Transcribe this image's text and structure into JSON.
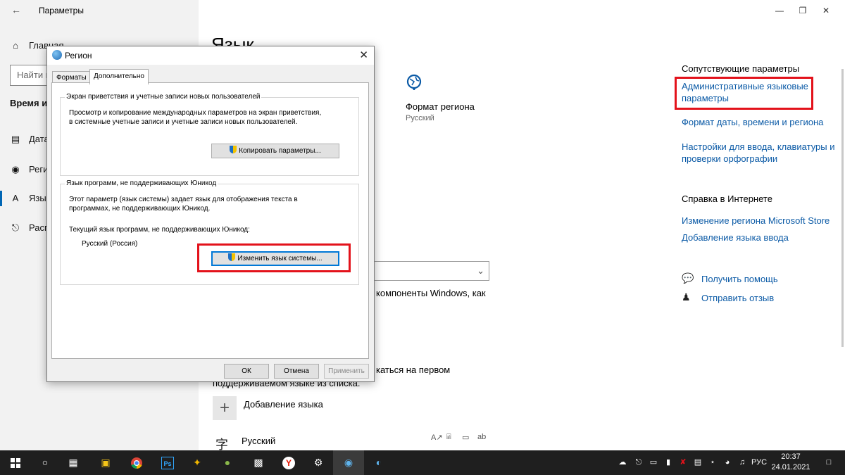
{
  "settings": {
    "window_title": "Параметры",
    "sidebar": {
      "home_label": "Главная",
      "search_placeholder": "Найти параметр",
      "section_label": "Время и язык",
      "items": [
        {
          "label": "Дата и время",
          "icon": "calendar-clock-icon"
        },
        {
          "label": "Регион",
          "icon": "globe-icon"
        },
        {
          "label": "Язык",
          "icon": "language-icon"
        },
        {
          "label": "Распознавание голоса",
          "icon": "microphone-icon"
        }
      ]
    },
    "main": {
      "page_title": "Язык",
      "region_format_label": "Формат региона",
      "region_format_value": "Русский",
      "bg_text_1": "компоненты Windows, как",
      "bg_text_2": "каться на первом",
      "bg_text_3": "поддерживаемом языке из списка.",
      "add_language_label": "Добавление языка",
      "installed_language": "Русский"
    },
    "related": {
      "heading": "Сопутствующие параметры",
      "links": [
        "Административные языковые параметры",
        "Формат даты, времени и региона",
        "Настройки для ввода, клавиатуры и проверки орфографии"
      ]
    },
    "help": {
      "heading": "Справка в Интернете",
      "links": [
        "Изменение региона Microsoft Store",
        "Добавление языка ввода"
      ],
      "get_help": "Получить помощь",
      "send_feedback": "Отправить отзыв"
    }
  },
  "dialog": {
    "title": "Регион",
    "tabs": [
      "Форматы",
      "Дополнительно"
    ],
    "active_tab": "Дополнительно",
    "welcome_group": {
      "title": "Экран приветствия и учетные записи новых пользователей",
      "description_line1": "Просмотр и копирование международных параметров на экран приветствия,",
      "description_line2": "в системные учетные записи и учетные записи новых пользователей.",
      "copy_button": "Копировать параметры..."
    },
    "unicode_group": {
      "title": "Язык программ, не поддерживающих Юникод",
      "description_line1": "Этот параметр (язык системы) задает язык для отображения текста в",
      "description_line2": "программах, не поддерживающих Юникод.",
      "current_label": "Текущий язык программ, не поддерживающих Юникод:",
      "current_value": "Русский (Россия)",
      "change_button": "Изменить язык системы..."
    },
    "ok_button": "ОК",
    "cancel_button": "Отмена",
    "apply_button": "Применить"
  },
  "taskbar": {
    "language": "РУС",
    "time": "20:37",
    "date": "24.01.2021"
  },
  "colors": {
    "highlight_red": "#e3121b",
    "link_blue": "#0b5aa6",
    "taskbar": "#1f1f1f"
  }
}
